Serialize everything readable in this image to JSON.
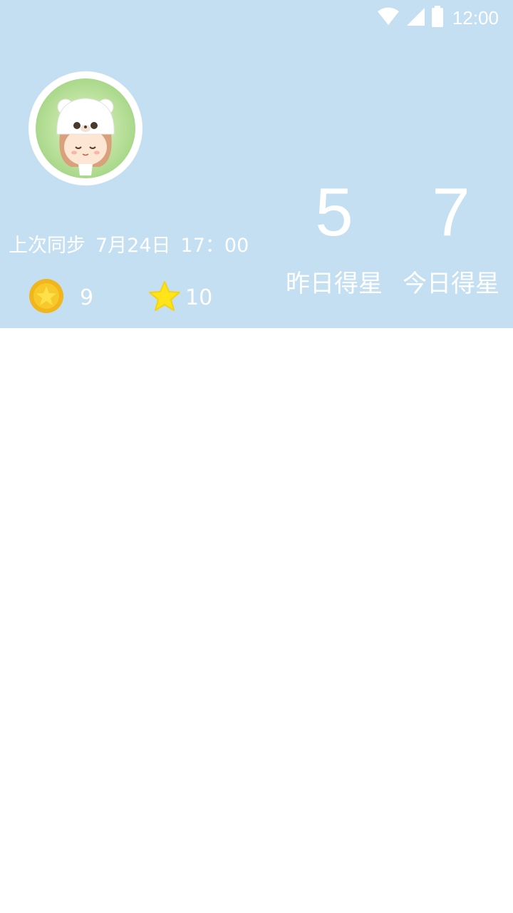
{
  "status_bar": {
    "time": "12:00",
    "icons": [
      "wifi-icon",
      "cellular-signal-icon",
      "battery-icon"
    ]
  },
  "profile": {
    "avatar": "avatar-girl-bear-hat",
    "sync_label": "上次同步",
    "sync_date": "7月24日",
    "sync_time": "17：00",
    "coins": "9",
    "stars": "10"
  },
  "stats": {
    "yesterday_value": "5",
    "yesterday_label": "昨日得星",
    "today_value": "7",
    "today_label": "今日得星"
  },
  "colors": {
    "header_background": "#c4dff2",
    "text": "#ffffff",
    "coin": "#f5c021",
    "star": "#ffe41a"
  }
}
